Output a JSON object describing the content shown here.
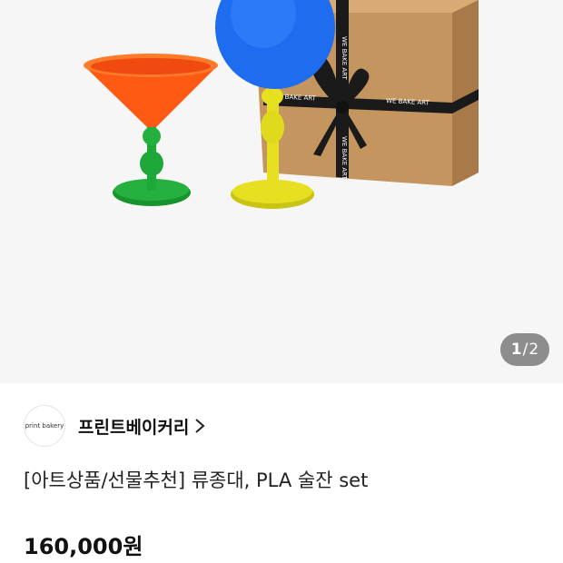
{
  "gallery": {
    "image_alt": "",
    "box_ribbon_text": "WE BAKE ART",
    "counter_current": "1",
    "counter_separator": "/",
    "counter_total": "2",
    "colors": {
      "background": "#f6f6f6",
      "martini_bowl": "#ff5a14",
      "martini_stem": "#1fa83a",
      "wine_bowl": "#1e6cf0",
      "wine_stem": "#e6e020",
      "box": "#c4955f",
      "ribbon": "#1a1a1a"
    }
  },
  "seller": {
    "avatar_text": "print bakery",
    "name": "프린트베이커리",
    "chevron_icon": "chevron-right-icon"
  },
  "product": {
    "title": "[아트상품/선물추천] 류종대, PLA 술잔 set",
    "price": "160,000원"
  }
}
